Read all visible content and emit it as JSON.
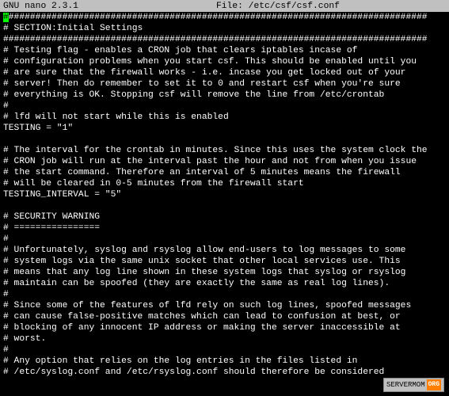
{
  "header": {
    "app_name": "GNU nano",
    "version": "2.3.1",
    "file_label": "File:",
    "file_path": "/etc/csf/csf.conf"
  },
  "lines": [
    {
      "prefix_cursor": "#",
      "text": "##############################################################################"
    },
    {
      "prefix": "#",
      "text": " SECTION:Initial Settings"
    },
    {
      "prefix": "#",
      "text": "##############################################################################"
    },
    {
      "prefix": "#",
      "text": " Testing flag - enables a CRON job that clears iptables incase of"
    },
    {
      "prefix": "#",
      "text": " configuration problems when you start csf. This should be enabled until you"
    },
    {
      "prefix": "#",
      "text": " are sure that the firewall works - i.e. incase you get locked out of your"
    },
    {
      "prefix": "#",
      "text": " server! Then do remember to set it to 0 and restart csf when you're sure"
    },
    {
      "prefix": "#",
      "text": " everything is OK. Stopping csf will remove the line from /etc/crontab"
    },
    {
      "prefix": "#",
      "text": ""
    },
    {
      "prefix": "#",
      "text": " lfd will not start while this is enabled"
    },
    {
      "prefix": "",
      "text": "TESTING = \"1\""
    },
    {
      "prefix": "",
      "text": ""
    },
    {
      "prefix": "#",
      "text": " The interval for the crontab in minutes. Since this uses the system clock the"
    },
    {
      "prefix": "#",
      "text": " CRON job will run at the interval past the hour and not from when you issue"
    },
    {
      "prefix": "#",
      "text": " the start command. Therefore an interval of 5 minutes means the firewall"
    },
    {
      "prefix": "#",
      "text": " will be cleared in 0-5 minutes from the firewall start"
    },
    {
      "prefix": "",
      "text": "TESTING_INTERVAL = \"5\""
    },
    {
      "prefix": "",
      "text": ""
    },
    {
      "prefix": "#",
      "text": " SECURITY WARNING"
    },
    {
      "prefix": "#",
      "text": " ================"
    },
    {
      "prefix": "#",
      "text": ""
    },
    {
      "prefix": "#",
      "text": " Unfortunately, syslog and rsyslog allow end-users to log messages to some"
    },
    {
      "prefix": "#",
      "text": " system logs via the same unix socket that other local services use. This"
    },
    {
      "prefix": "#",
      "text": " means that any log line shown in these system logs that syslog or rsyslog"
    },
    {
      "prefix": "#",
      "text": " maintain can be spoofed (they are exactly the same as real log lines)."
    },
    {
      "prefix": "#",
      "text": ""
    },
    {
      "prefix": "#",
      "text": " Since some of the features of lfd rely on such log lines, spoofed messages"
    },
    {
      "prefix": "#",
      "text": " can cause false-positive matches which can lead to confusion at best, or"
    },
    {
      "prefix": "#",
      "text": " blocking of any innocent IP address or making the server inaccessible at"
    },
    {
      "prefix": "#",
      "text": " worst."
    },
    {
      "prefix": "#",
      "text": ""
    },
    {
      "prefix": "#",
      "text": " Any option that relies on the log entries in the files listed in"
    },
    {
      "prefix": "#",
      "text": " /etc/syslog.conf and /etc/rsyslog.conf should therefore be considered"
    }
  ],
  "watermark": {
    "brand": "SERVERMOM",
    "tld": "ORG"
  }
}
